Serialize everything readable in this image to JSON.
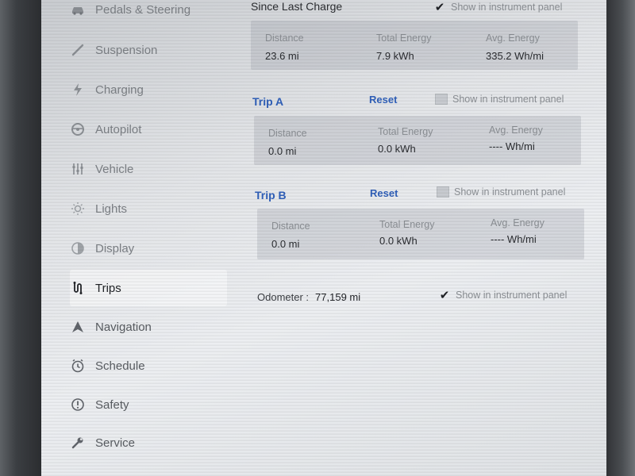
{
  "sidebar": {
    "items": [
      {
        "label": "Pedals & Steering",
        "icon": "car-icon"
      },
      {
        "label": "Suspension",
        "icon": "suspension-icon"
      },
      {
        "label": "Charging",
        "icon": "lightning-icon"
      },
      {
        "label": "Autopilot",
        "icon": "steering-wheel-icon"
      },
      {
        "label": "Vehicle",
        "icon": "sliders-icon"
      },
      {
        "label": "Lights",
        "icon": "light-icon"
      },
      {
        "label": "Display",
        "icon": "display-icon"
      },
      {
        "label": "Trips",
        "icon": "trips-icon"
      },
      {
        "label": "Navigation",
        "icon": "navigation-icon"
      },
      {
        "label": "Schedule",
        "icon": "clock-icon"
      },
      {
        "label": "Safety",
        "icon": "alert-icon"
      },
      {
        "label": "Service",
        "icon": "wrench-icon"
      }
    ],
    "active": "Trips"
  },
  "since_last_charge": {
    "title": "Since Last Charge",
    "show_label": "Show in instrument panel",
    "show_checked": true,
    "distance_label": "Distance",
    "distance_value": "23.6 mi",
    "energy_label": "Total Energy",
    "energy_value": "7.9 kWh",
    "avg_label": "Avg. Energy",
    "avg_value": "335.2 Wh/mi"
  },
  "trip_a": {
    "title": "Trip A",
    "reset_label": "Reset",
    "show_label": "Show in instrument panel",
    "show_checked": false,
    "distance_label": "Distance",
    "distance_value": "0.0 mi",
    "energy_label": "Total Energy",
    "energy_value": "0.0 kWh",
    "avg_label": "Avg. Energy",
    "avg_value": "---- Wh/mi"
  },
  "trip_b": {
    "title": "Trip B",
    "reset_label": "Reset",
    "show_label": "Show in instrument panel",
    "show_checked": false,
    "distance_label": "Distance",
    "distance_value": "0.0 mi",
    "energy_label": "Total Energy",
    "energy_value": "0.0 kWh",
    "avg_label": "Avg. Energy",
    "avg_value": "---- Wh/mi"
  },
  "odometer": {
    "label": "Odometer :",
    "value": "77,159 mi",
    "show_label": "Show in instrument panel",
    "show_checked": true
  },
  "colors": {
    "accent": "#2f5fb8",
    "screen_bg": "#e3e5e8",
    "active_text": "#222428"
  }
}
